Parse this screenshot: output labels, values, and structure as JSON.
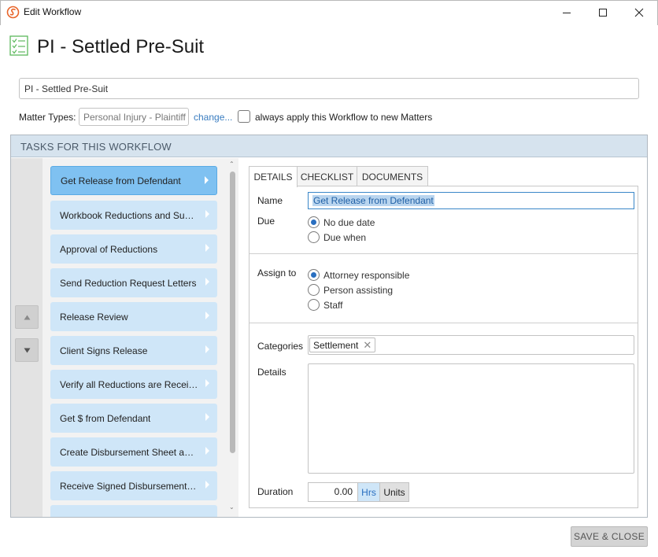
{
  "window": {
    "title": "Edit Workflow",
    "app_icon": "app-logo-icon",
    "controls": [
      "minimize-icon",
      "maximize-icon",
      "close-icon"
    ]
  },
  "header": {
    "icon": "checklist-icon",
    "title": "PI - Settled Pre-Suit"
  },
  "form": {
    "name_value": "PI - Settled Pre-Suit",
    "matter_types_label": "Matter Types:",
    "matter_types_value": "Personal Injury - Plaintiff",
    "change_link": "change...",
    "always_apply_label": "always apply this Workflow to new Matters",
    "always_apply_checked": false
  },
  "tasks": {
    "header": "TASKS FOR THIS WORKFLOW",
    "move_up_icon": "triangle-up-icon",
    "move_down_icon": "triangle-down-icon",
    "items": [
      {
        "label": "Get Release from Defendant",
        "selected": true
      },
      {
        "label": "Workbook Reductions and Subm...",
        "selected": false
      },
      {
        "label": "Approval of Reductions",
        "selected": false
      },
      {
        "label": "Send Reduction Request Letters",
        "selected": false
      },
      {
        "label": "Release Review",
        "selected": false
      },
      {
        "label": "Client Signs Release",
        "selected": false
      },
      {
        "label": "Verify all Reductions are Receive...",
        "selected": false
      },
      {
        "label": "Get $ from Defendant",
        "selected": false
      },
      {
        "label": "Create Disbursement Sheet and...",
        "selected": false
      },
      {
        "label": "Receive Signed Disbursement Sh...",
        "selected": false
      },
      {
        "label": "",
        "selected": false
      }
    ]
  },
  "detail": {
    "tabs": [
      "DETAILS",
      "CHECKLIST",
      "DOCUMENTS"
    ],
    "active_tab": "DETAILS",
    "name_label": "Name",
    "name_value": "Get Release from Defendant",
    "due_label": "Due",
    "due_options": [
      {
        "label": "No due date",
        "checked": true
      },
      {
        "label": "Due when",
        "checked": false
      }
    ],
    "assign_label": "Assign to",
    "assign_options": [
      {
        "label": "Attorney responsible",
        "checked": true
      },
      {
        "label": "Person assisting",
        "checked": false
      },
      {
        "label": "Staff",
        "checked": false
      }
    ],
    "categories_label": "Categories",
    "category_tag": "Settlement",
    "details_label": "Details",
    "details_value": "",
    "duration_label": "Duration",
    "duration_value": "0.00",
    "hrs_label": "Hrs",
    "units_label": "Units"
  },
  "footer": {
    "save_close": "SAVE & CLOSE"
  },
  "colors": {
    "accent": "#2a6fc0",
    "task_bg": "#cfe6f8",
    "task_selected_bg": "#7fc1f1",
    "section_header_bg": "#d6e3ee"
  }
}
